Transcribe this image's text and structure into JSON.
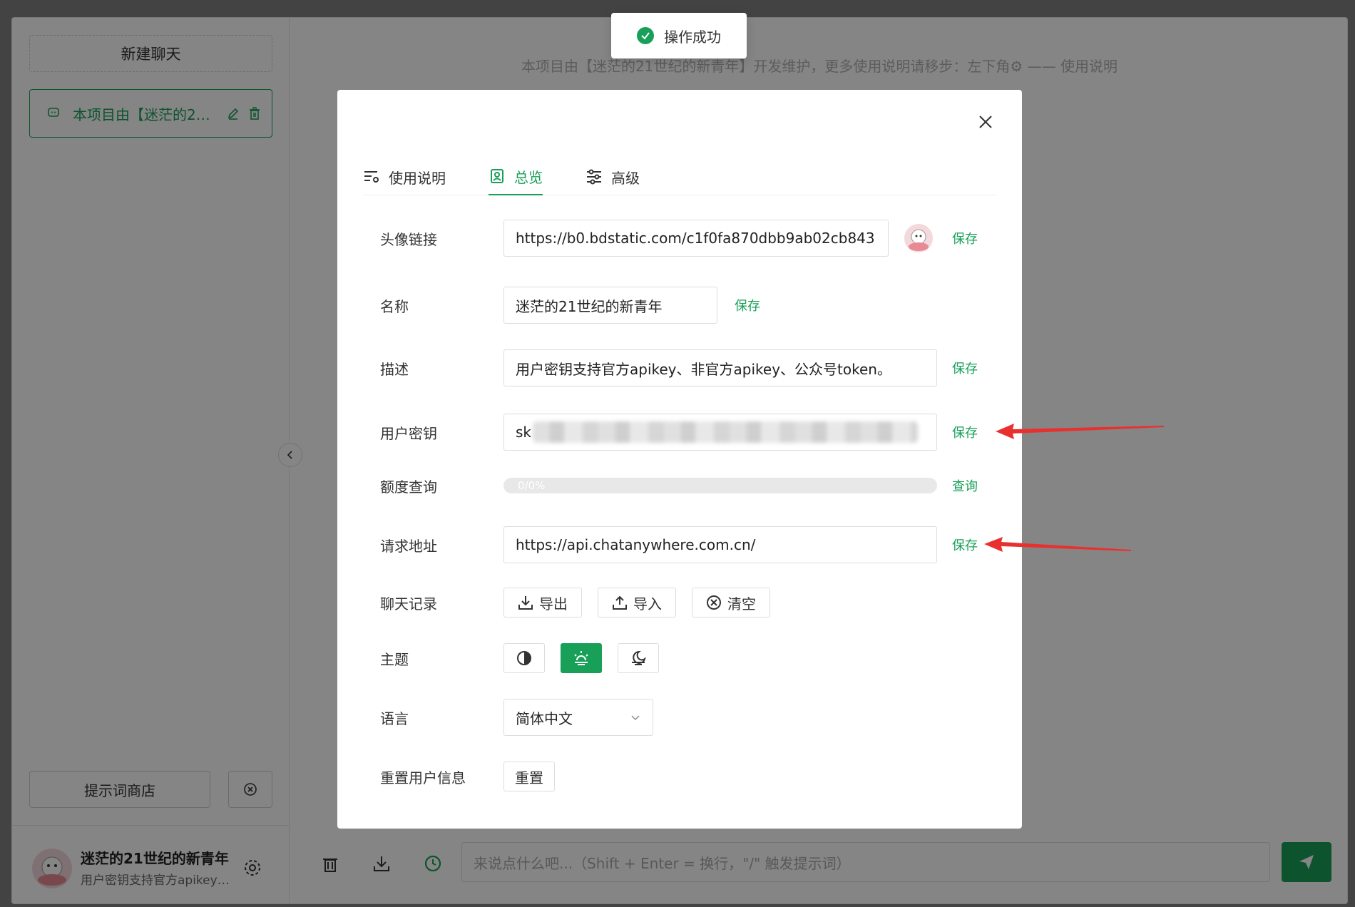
{
  "sidebar": {
    "new_chat": "新建聊天",
    "chat_item": "本项目由【迷茫的21世纪的新青年】开发维护",
    "prompt_store": "提示词商店",
    "user_name": "迷茫的21世纪的新青年",
    "user_desc": "用户密钥支持官方apikey、非官方apikey、公众号token。"
  },
  "main": {
    "notice": "本项目由【迷茫的21世纪的新青年】开发维护，更多使用说明请移步：左下角⚙ —— 使用说明",
    "input_placeholder": "来说点什么吧...（Shift + Enter = 换行，\"/\" 触发提示词）"
  },
  "toast": {
    "text": "操作成功"
  },
  "modal": {
    "tabs": [
      {
        "label": "使用说明",
        "icon": "list-settings-icon"
      },
      {
        "label": "总览",
        "icon": "id-card-icon"
      },
      {
        "label": "高级",
        "icon": "sliders-icon"
      }
    ],
    "active_tab": "总览",
    "avatar": {
      "label": "头像链接",
      "value": "https://b0.bdstatic.com/c1f0fa870dbb9ab02cb843",
      "save": "保存"
    },
    "name": {
      "label": "名称",
      "value": "迷茫的21世纪的新青年",
      "save": "保存"
    },
    "description": {
      "label": "描述",
      "value": "用户密钥支持官方apikey、非官方apikey、公众号token。",
      "save": "保存"
    },
    "api_key": {
      "label": "用户密钥",
      "value": "sk",
      "save": "保存"
    },
    "quota": {
      "label": "额度查询",
      "progress_text": "0/0%",
      "progress": 0,
      "query": "查询"
    },
    "base_url": {
      "label": "请求地址",
      "value": "https://api.chatanywhere.com.cn/",
      "save": "保存"
    },
    "history": {
      "label": "聊天记录",
      "export": "导出",
      "import": "导入",
      "clear": "清空"
    },
    "theme": {
      "label": "主题",
      "options": [
        "auto",
        "light",
        "dark"
      ],
      "selected": "light"
    },
    "language": {
      "label": "语言",
      "value": "简体中文"
    },
    "reset": {
      "label": "重置用户信息",
      "button": "重置"
    }
  },
  "colors": {
    "accent": "#18a058",
    "arrow": "#e8312f"
  }
}
